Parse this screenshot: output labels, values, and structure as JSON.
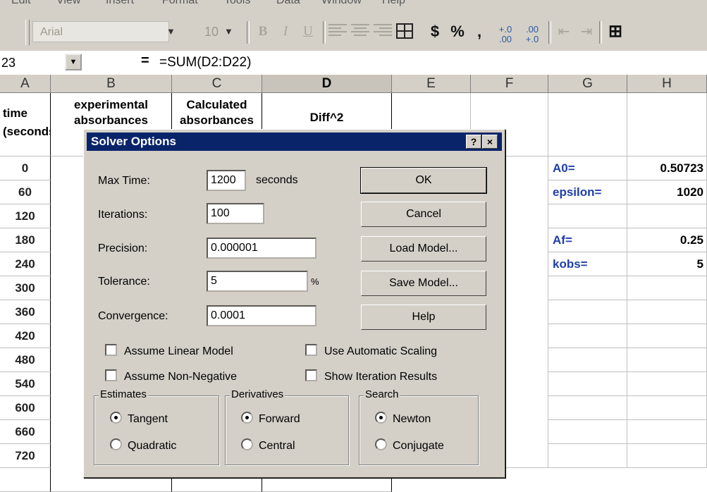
{
  "menubar": {
    "items": [
      "Edit",
      "View",
      "Insert",
      "Format",
      "Tools",
      "Data",
      "Window",
      "Help"
    ]
  },
  "toolbar": {
    "font_name": "Arial",
    "font_size": "10",
    "bold": "B",
    "italic": "I",
    "underline": "U",
    "currency": "$",
    "percent": "%",
    "comma": ",",
    "inc_decimal": ".00→.0",
    "dec_decimal": ".0→.00"
  },
  "formula_bar": {
    "cell_ref": "23",
    "equals": "=",
    "formula": "=SUM(D2:D22)"
  },
  "columns": [
    "A",
    "B",
    "C",
    "D",
    "E",
    "F",
    "G",
    "H"
  ],
  "sheet": {
    "header": {
      "a": "time\n(seconds)",
      "b": "experimental\nabsorbances",
      "c": "Calculated\nabsorbances",
      "d": "Diff^2"
    },
    "times": [
      "0",
      "60",
      "120",
      "180",
      "240",
      "300",
      "360",
      "420",
      "480",
      "540",
      "600",
      "660",
      "720"
    ],
    "params": [
      {
        "label": "A0=",
        "value": "0.50723"
      },
      {
        "label": "epsilon=",
        "value": "1020"
      },
      {
        "label": "",
        "value": ""
      },
      {
        "label": "Af=",
        "value": "0.25"
      },
      {
        "label": "kobs=",
        "value": "5"
      }
    ]
  },
  "dialog": {
    "title": "Solver Options",
    "help_btn": "?",
    "close_btn": "×",
    "max_time_label": "Max Time:",
    "max_time": "1200",
    "seconds_label": "seconds",
    "iterations_label": "Iterations:",
    "iterations": "100",
    "precision_label": "Precision:",
    "precision": "0.000001",
    "tolerance_label": "Tolerance:",
    "tolerance": "5",
    "percent": "%",
    "convergence_label": "Convergence:",
    "convergence": "0.0001",
    "buttons": {
      "ok": "OK",
      "cancel": "Cancel",
      "load": "Load Model...",
      "save": "Save Model...",
      "help": "Help"
    },
    "checkboxes": {
      "linear": "Assume Linear Model",
      "nonneg": "Assume Non-Negative",
      "autoscale": "Use Automatic Scaling",
      "show_iter": "Show Iteration Results"
    },
    "estimates": {
      "legend": "Estimates",
      "opt1": "Tangent",
      "opt2": "Quadratic",
      "selected": "Tangent"
    },
    "derivatives": {
      "legend": "Derivatives",
      "opt1": "Forward",
      "opt2": "Central",
      "selected": "Forward"
    },
    "search": {
      "legend": "Search",
      "opt1": "Newton",
      "opt2": "Conjugate",
      "selected": "Newton"
    }
  }
}
